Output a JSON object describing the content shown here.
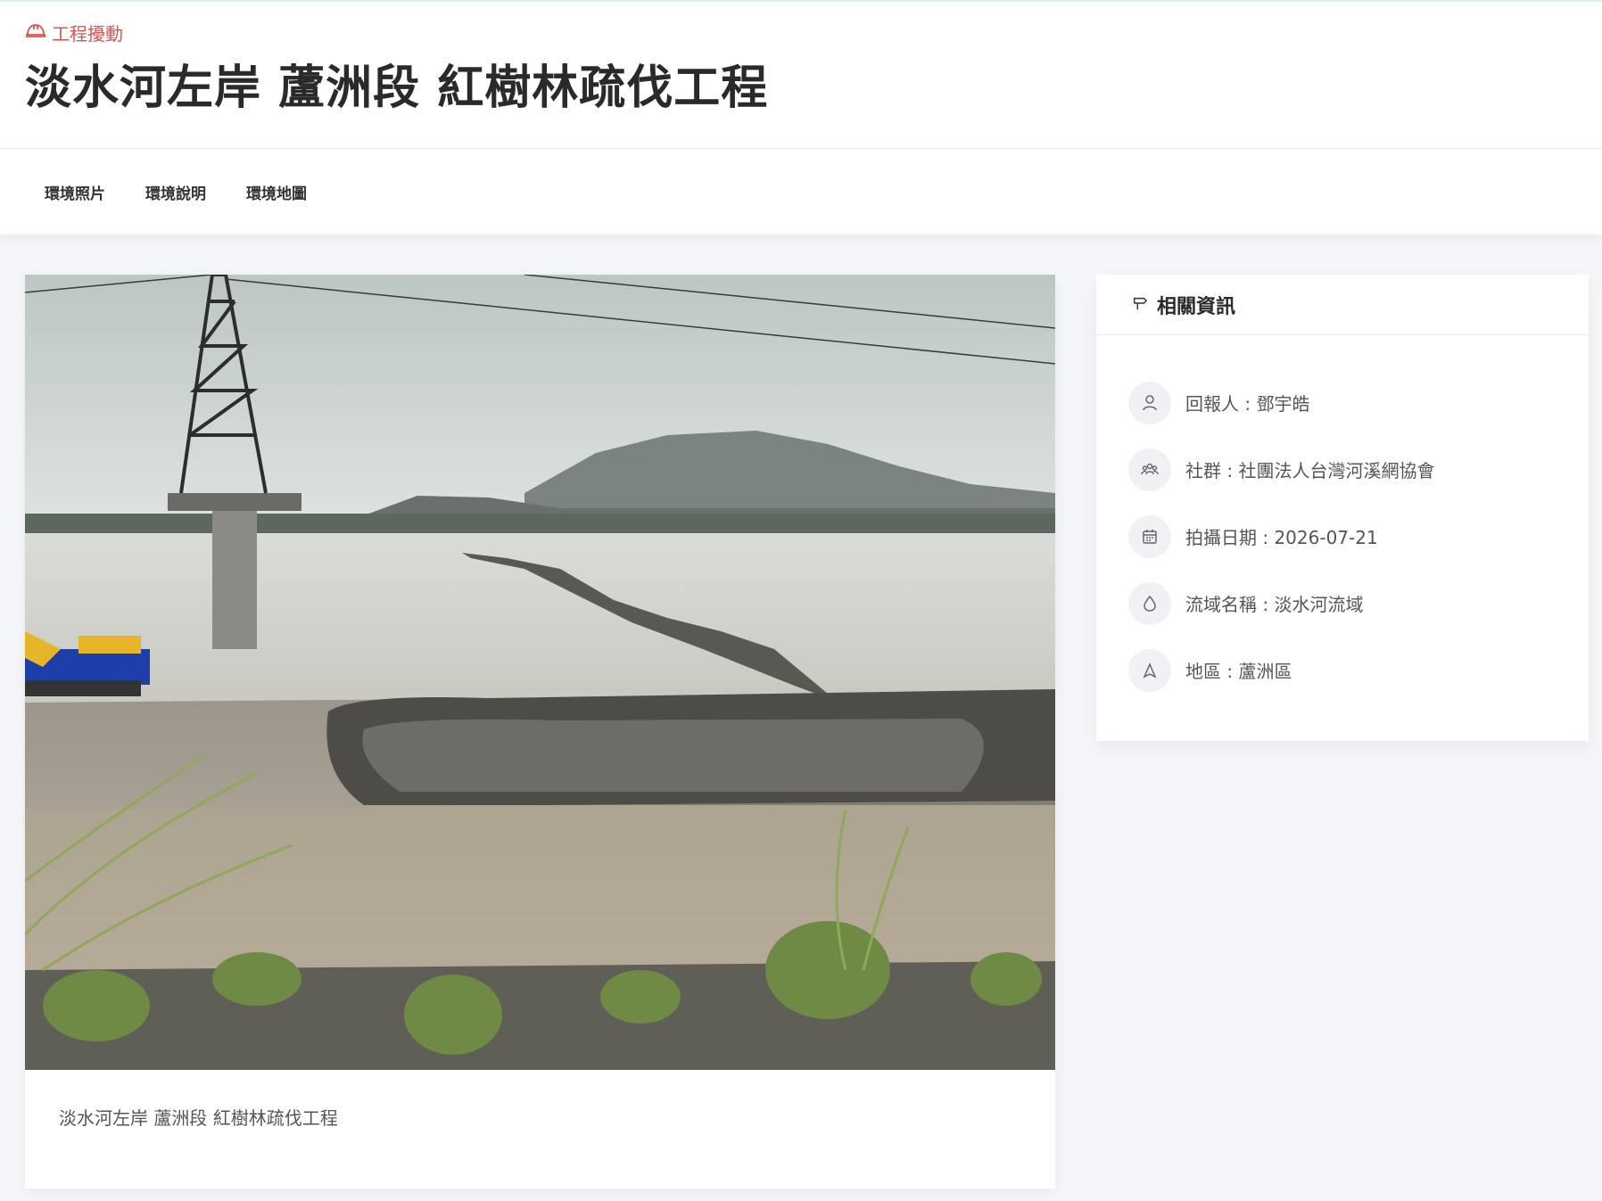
{
  "header": {
    "category": "工程擾動",
    "category_icon": "hard-hat-icon",
    "title": "淡水河左岸 蘆洲段 紅樹林疏伐工程"
  },
  "tabs": [
    {
      "label": "環境照片"
    },
    {
      "label": "環境說明"
    },
    {
      "label": "環境地圖"
    }
  ],
  "photo": {
    "caption": "淡水河左岸 蘆洲段 紅樹林疏伐工程"
  },
  "info": {
    "title": "相關資訊",
    "title_icon": "signpost-icon",
    "items": [
      {
        "icon": "user-icon",
        "text": "回報人 : 鄧宇皓"
      },
      {
        "icon": "group-icon",
        "text": "社群 : 社團法人台灣河溪網協會"
      },
      {
        "icon": "calendar-icon",
        "text": "拍攝日期 : 2026-07-21"
      },
      {
        "icon": "water-drop-icon",
        "text": "流域名稱 : 淡水河流域"
      },
      {
        "icon": "location-arrow-icon",
        "text": "地區 : 蘆洲區"
      }
    ]
  },
  "colors": {
    "category": "#d9534f",
    "background": "#f5f6f9",
    "card": "#ffffff"
  }
}
